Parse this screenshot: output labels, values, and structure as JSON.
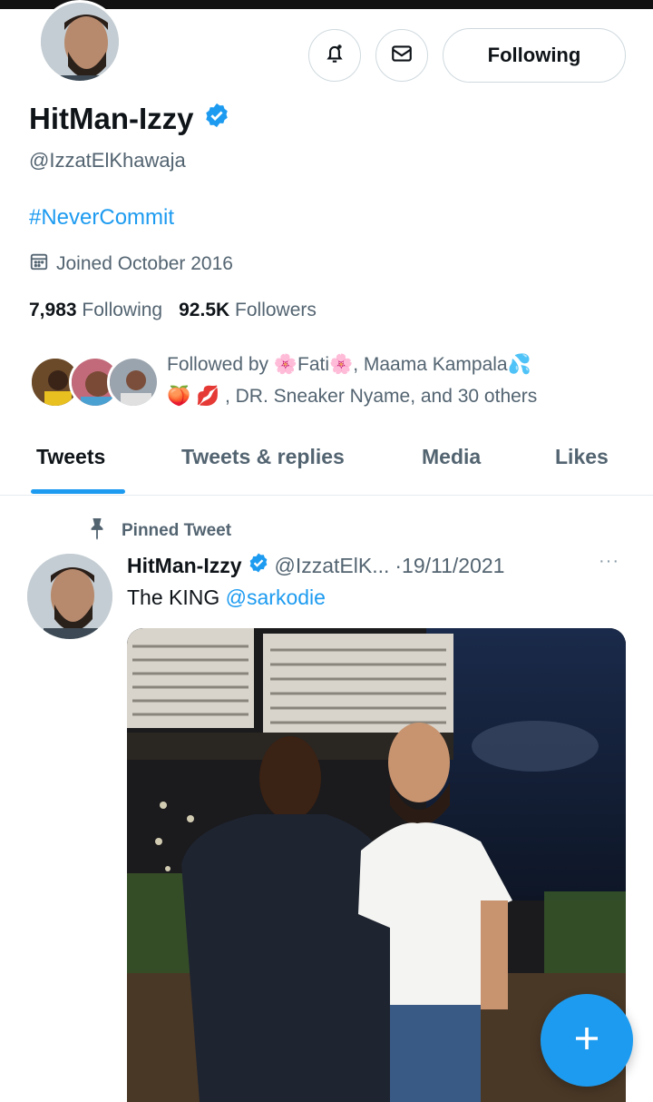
{
  "profile": {
    "display_name": "HitMan-Izzy",
    "handle": "@IzzatElKhawaja",
    "bio": "#NeverCommit",
    "joined": "Joined October 2016",
    "following_count": "7,983",
    "following_label": "Following",
    "followers_count": "92.5K",
    "followers_label": "Followers",
    "follow_button": "Following",
    "followed_by_line1": "Followed by 🌸Fati🌸, Maama Kampala💦",
    "followed_by_line2": "🍑 💋 , DR. Sneaker Nyame, and 30 others"
  },
  "icons": {
    "notify": "bell-plus-icon",
    "message": "envelope-icon",
    "verified": "verified-badge-icon",
    "calendar": "calendar-icon",
    "pin": "pin-icon",
    "compose": "plus-icon"
  },
  "tabs": [
    {
      "label": "Tweets",
      "active": true
    },
    {
      "label": "Tweets & replies",
      "active": false
    },
    {
      "label": "Media",
      "active": false
    },
    {
      "label": "Likes",
      "active": false
    }
  ],
  "pinned_tweet": {
    "pinned_label": "Pinned Tweet",
    "author": "HitMan-Izzy",
    "handle": "@IzzatElK...",
    "date": "·19/11/2021",
    "more": "···",
    "text": "The KING ",
    "mention": "@sarkodie"
  },
  "colors": {
    "accent": "#1d9bf0",
    "secondary_text": "#536471",
    "primary_text": "#0f1419"
  }
}
